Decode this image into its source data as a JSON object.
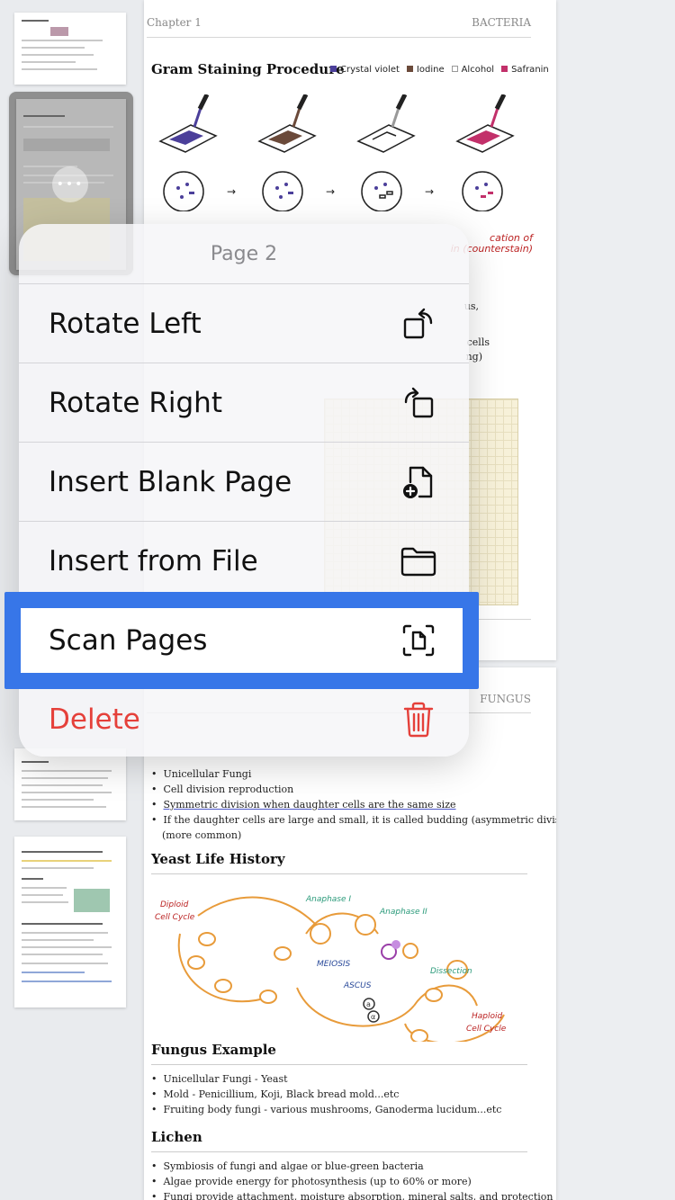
{
  "page1": {
    "chapter": "Chapter 1",
    "header_right": "BACTERIA",
    "title": "Gram Staining Procedure",
    "legend": [
      {
        "label": "Crystal violet",
        "color": "#4b3f9a"
      },
      {
        "label": "Iodine",
        "color": "#6b4a3a"
      },
      {
        "label": "Alcohol",
        "color": "#ffffff"
      },
      {
        "label": "Safranin",
        "color": "#c2306a"
      }
    ],
    "partial_texts": [
      "cation of",
      "in (counterstain)",
      "us,",
      "cells",
      "ng)"
    ]
  },
  "page2": {
    "header_right": "FUNGUS",
    "bullets_top": [
      "Unicellular Fungi",
      "Cell division reproduction",
      "Symmetric division when daughter cells are the same size",
      "If the daughter cells are large and small, it is called budding (asymmetric division)",
      "(more common)"
    ],
    "section_yeast": "Yeast Life History",
    "diagram_labels": {
      "diploid": "Diploid",
      "diploid2": "Cell Cycle",
      "anaphase1": "Anaphase I",
      "anaphase2": "Anaphase II",
      "meiosis": "MEIOSIS",
      "ascus": "ASCUS",
      "dissection": "Dissection",
      "haploid": "Haploid",
      "haploid2": "Cell Cycle",
      "a": "a",
      "alpha": "α"
    },
    "section_example": "Fungus Example",
    "bullets_example": [
      "Unicellular Fungi - Yeast",
      "Mold - Penicillium, Koji, Black bread mold...etc",
      "Fruiting body fungi - various mushrooms, Ganoderma lucidum...etc"
    ],
    "section_lichen": "Lichen",
    "bullets_lichen": [
      "Symbiosis of fungi and algae or blue-green bacteria",
      "Algae provide energy for photosynthesis (up to 60% or more)",
      "Fungi provide attachment, moisture absorption, mineral salts, and protection"
    ]
  },
  "menu": {
    "title": "Page 2",
    "items": [
      {
        "label": "Rotate Left",
        "icon": "rotate-left-icon"
      },
      {
        "label": "Rotate Right",
        "icon": "rotate-right-icon"
      },
      {
        "label": "Insert Blank Page",
        "icon": "doc-plus-icon"
      },
      {
        "label": "Insert from File",
        "icon": "folder-icon"
      },
      {
        "label": "Scan Pages",
        "icon": "doc-scan-icon"
      },
      {
        "label": "Delete",
        "icon": "trash-icon",
        "color": "#e5403a"
      }
    ],
    "highlight_color": "#3776e8"
  }
}
